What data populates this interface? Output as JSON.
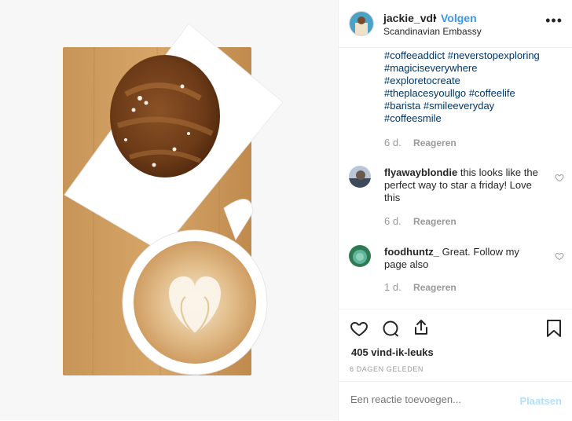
{
  "post": {
    "username": "jackie_vdl",
    "follow_label": "Volgen",
    "separator": "•",
    "location": "Scandinavian Embassy",
    "more_label": "•••"
  },
  "caption": {
    "hashtag_lines": [
      "#coffeeaddict #neverstopexploring",
      "#magiciseverywhere",
      "#exploretocreate",
      "#theplacesyoullgo #coffeelife",
      "#barista #smileeveryday",
      "#coffeesmile"
    ],
    "time": "6 d.",
    "reply_label": "Reageren"
  },
  "comments": [
    {
      "username": "flyawayblondie",
      "text": "this looks like the perfect way to star a friday! Love this",
      "time": "6 d.",
      "reply_label": "Reageren"
    },
    {
      "username": "foodhuntz_",
      "text": "Great. Follow my page also",
      "time": "1 d.",
      "reply_label": "Reageren"
    }
  ],
  "actions": {
    "icons": [
      "heart-icon",
      "comment-icon",
      "share-icon",
      "bookmark-icon"
    ],
    "likes_text": "405 vind-ik-leuks",
    "date_text": "6 DAGEN GELEDEN"
  },
  "add_comment": {
    "placeholder": "Een reactie toevoegen...",
    "post_label": "Plaatsen"
  },
  "colors": {
    "link": "#3897f0",
    "hashtag": "#003569",
    "muted": "#999999",
    "text": "#262626",
    "post_disabled": "#b2dffc"
  }
}
